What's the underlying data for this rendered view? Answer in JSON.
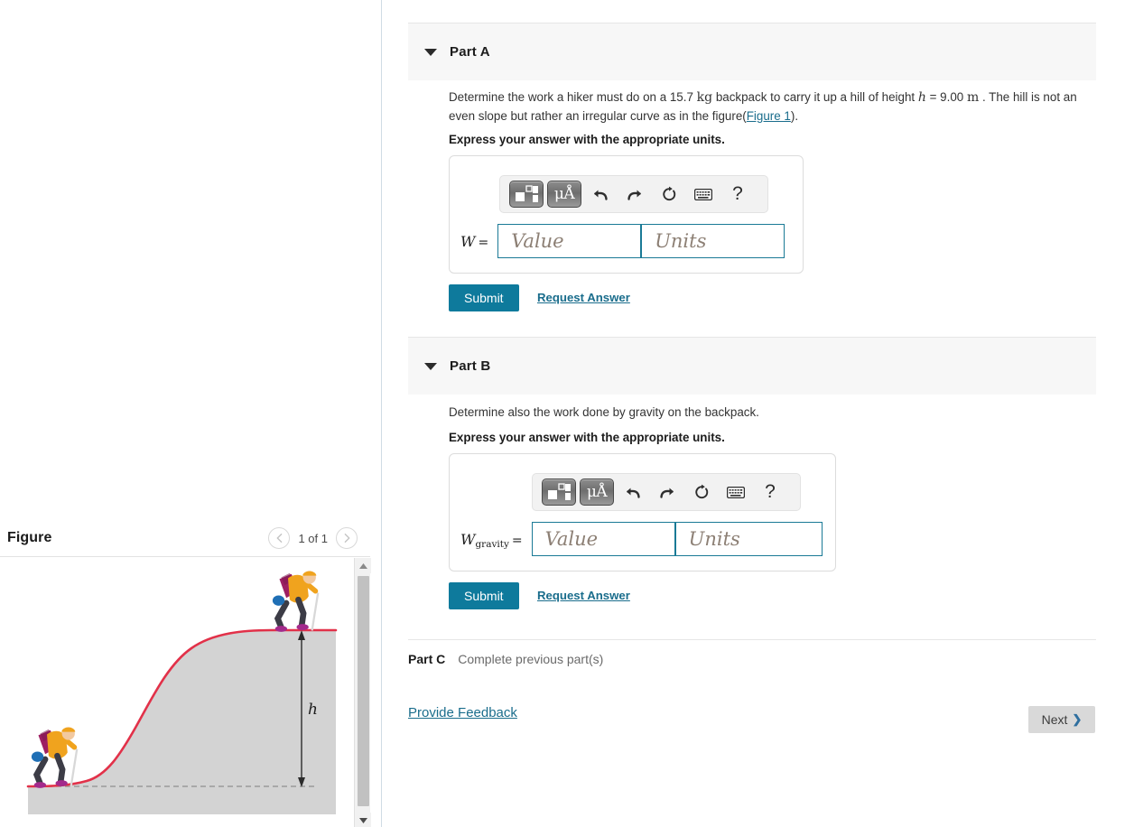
{
  "figure_panel": {
    "title": "Figure",
    "prev_icon": "chevron-left-icon",
    "next_icon": "chevron-right-icon",
    "counter": "1 of 1",
    "diagram": {
      "height_label": "h",
      "curve_color": "#e23149",
      "hill_fill": "#d3d3d3",
      "baseline_style": "dashed",
      "hiker_jacket_color": "#f0a31e",
      "hiker_pack_color": "#9e1f63",
      "hiker_roll_color": "#1f6fb5",
      "hiker_pants_color": "#3c3c46",
      "hiker_boot_color": "#a32a8c"
    },
    "scrollbar": {
      "up_icon": "scroll-up-arrow-icon",
      "down_icon": "scroll-down-arrow-icon"
    }
  },
  "parts": {
    "a": {
      "caret_icon": "caret-down-icon",
      "label": "Part A",
      "prompt_1": "Determine the work a hiker must do on a 15.7 ",
      "prompt_kg": "kg",
      "prompt_2": " backpack to carry it up a hill of height ",
      "prompt_h": "h",
      "prompt_3": " = 9.00 ",
      "prompt_m": "m",
      "prompt_4": " . The hill is not an even slope but rather an irregular curve as in the figure(",
      "figure_link": "Figure 1",
      "prompt_5": ").",
      "express": "Express your answer with the appropriate units.",
      "answer_symbol": "W",
      "answer_subscript": "",
      "equals": "=",
      "value_placeholder": "Value",
      "units_placeholder": "Units",
      "submit_label": "Submit",
      "request_label": "Request Answer"
    },
    "b": {
      "caret_icon": "caret-down-icon",
      "label": "Part B",
      "prompt": "Determine also the work done by gravity on the backpack.",
      "express": "Express your answer with the appropriate units.",
      "answer_symbol": "W",
      "answer_subscript": "gravity",
      "equals": "=",
      "value_placeholder": "Value",
      "units_placeholder": "Units",
      "submit_label": "Submit",
      "request_label": "Request Answer"
    },
    "c": {
      "label": "Part C",
      "status": "Complete previous part(s)"
    }
  },
  "editor_toolbar": {
    "template_button": "math-template-icon",
    "units_button": "μÅ",
    "undo": "undo-icon",
    "redo": "redo-icon",
    "reset": "reset-icon",
    "keyboard": "keyboard-icon",
    "help": "?"
  },
  "footer": {
    "feedback_label": "Provide Feedback",
    "next_label": "Next",
    "next_icon": "chevron-right-icon"
  },
  "colors": {
    "accent_teal": "#0e7a9c",
    "link_blue": "#1a6d8c",
    "band_gray": "#f7f7f7",
    "next_gray": "#d9d9d9"
  }
}
